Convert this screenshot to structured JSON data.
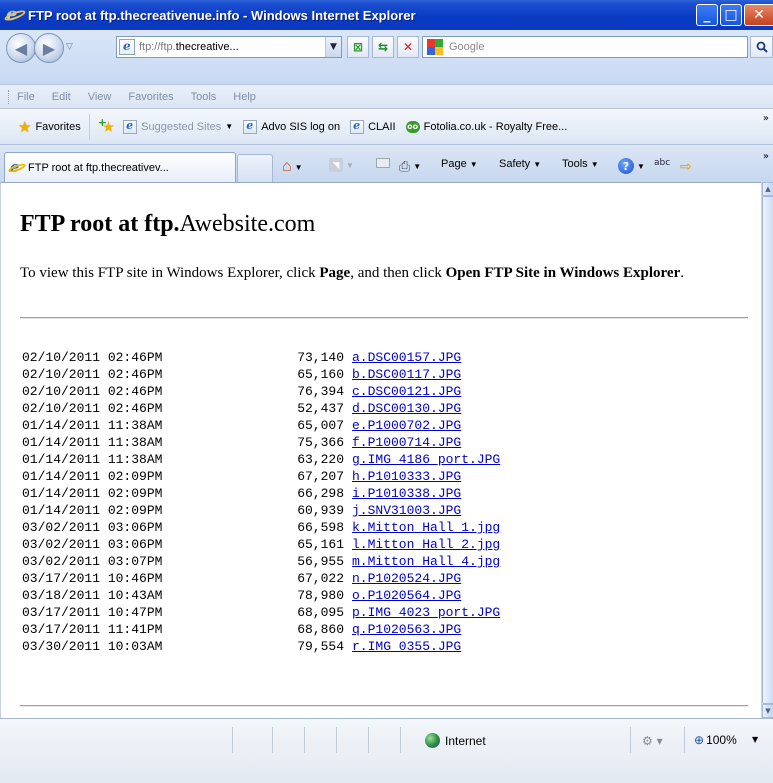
{
  "window": {
    "title": "FTP root at ftp.thecreativenue.info - Windows Internet Explorer"
  },
  "address_bar": {
    "url_prefix": "ftp://ftp.",
    "url_host": "thecreative...",
    "search_placeholder": "Google"
  },
  "menu": [
    "File",
    "Edit",
    "View",
    "Favorites",
    "Tools",
    "Help"
  ],
  "favorites_bar": {
    "favorites_label": "Favorites",
    "items": [
      {
        "label": "Suggested Sites",
        "icon": "ie-page-icon",
        "has_dropdown": true,
        "muted": true
      },
      {
        "label": "Advo SIS log on",
        "icon": "ie-page-icon",
        "has_dropdown": false,
        "muted": false
      },
      {
        "label": "CLAII",
        "icon": "ie-page-icon",
        "has_dropdown": false,
        "muted": false
      },
      {
        "label": "Fotolia.co.uk - Royalty Free...",
        "icon": "fotolia-icon",
        "has_dropdown": false,
        "muted": false
      }
    ]
  },
  "tab": {
    "label": "FTP root at ftp.thecreativev..."
  },
  "command_bar": {
    "page_label": "Page",
    "safety_label": "Safety",
    "tools_label": "Tools",
    "spell_icon_text": "abc"
  },
  "content": {
    "title_bold": "FTP root at ftp.",
    "title_rest": "Awebsite.com",
    "intro_text_1": "To view this FTP site in Windows Explorer, click ",
    "intro_bold_1": "Page",
    "intro_text_2": ", and then click ",
    "intro_bold_2": "Open FTP Site in Windows Explorer",
    "intro_text_3": ".",
    "files": [
      {
        "date": "02/10/2011 02:46PM",
        "size": "73,140",
        "name": "a.DSC00157.JPG"
      },
      {
        "date": "02/10/2011 02:46PM",
        "size": "65,160",
        "name": "b.DSC00117.JPG"
      },
      {
        "date": "02/10/2011 02:46PM",
        "size": "76,394",
        "name": "c.DSC00121.JPG"
      },
      {
        "date": "02/10/2011 02:46PM",
        "size": "52,437",
        "name": "d.DSC00130.JPG"
      },
      {
        "date": "01/14/2011 11:38AM",
        "size": "65,007",
        "name": "e.P1000702.JPG"
      },
      {
        "date": "01/14/2011 11:38AM",
        "size": "75,366",
        "name": "f.P1000714.JPG"
      },
      {
        "date": "01/14/2011 11:38AM",
        "size": "63,220",
        "name": "g.IMG_4186_port.JPG"
      },
      {
        "date": "01/14/2011 02:09PM",
        "size": "67,207",
        "name": "h.P1010333.JPG"
      },
      {
        "date": "01/14/2011 02:09PM",
        "size": "66,298",
        "name": "i.P1010338.JPG"
      },
      {
        "date": "01/14/2011 02:09PM",
        "size": "60,939",
        "name": "j.SNV31003.JPG"
      },
      {
        "date": "03/02/2011 03:06PM",
        "size": "66,598",
        "name": "k.Mitton Hall 1.jpg"
      },
      {
        "date": "03/02/2011 03:06PM",
        "size": "65,161",
        "name": "l.Mitton Hall 2.jpg"
      },
      {
        "date": "03/02/2011 03:07PM",
        "size": "56,955",
        "name": "m.Mitton Hall 4.jpg"
      },
      {
        "date": "03/17/2011 10:46PM",
        "size": "67,022",
        "name": "n.P1020524.JPG"
      },
      {
        "date": "03/18/2011 10:43AM",
        "size": "78,980",
        "name": "o.P1020564.JPG"
      },
      {
        "date": "03/17/2011 10:47PM",
        "size": "68,095",
        "name": "p.IMG_4023_port.JPG"
      },
      {
        "date": "03/17/2011 11:41PM",
        "size": "68,860",
        "name": "q.P1020563.JPG"
      },
      {
        "date": "03/30/2011 10:03AM",
        "size": "79,554",
        "name": "r.IMG_0355.JPG"
      }
    ]
  },
  "status_bar": {
    "zone": "Internet",
    "zoom": "100%"
  },
  "colors": {
    "titlebar": "#0a3bc4",
    "link": "#0000cc",
    "close_button": "#c8401d"
  }
}
